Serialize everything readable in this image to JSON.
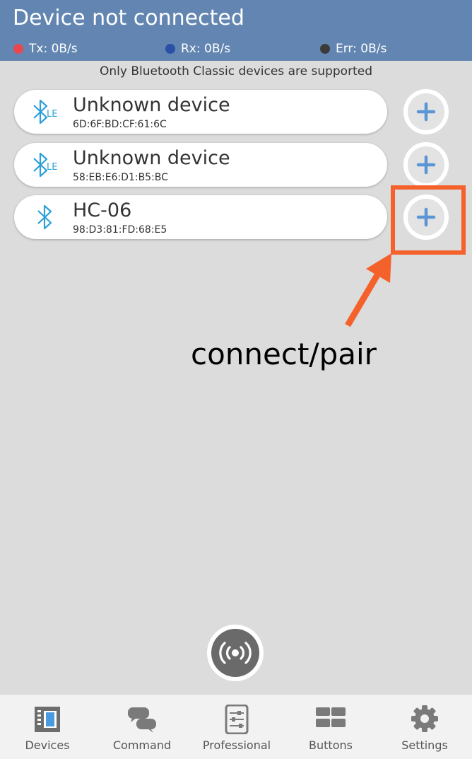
{
  "header": {
    "title": "Device not connected",
    "tx_label": "Tx: 0B/s",
    "rx_label": "Rx: 0B/s",
    "err_label": "Err: 0B/s",
    "tx_color": "#e8474f",
    "rx_color": "#2a4fa6",
    "err_color": "#3b3b3b"
  },
  "notice": "Only Bluetooth Classic devices are supported",
  "devices": [
    {
      "name": "Unknown device",
      "mac": "6D:6F:BD:CF:61:6C",
      "icon": "bluetooth-le-icon"
    },
    {
      "name": "Unknown device",
      "mac": "58:EB:E6:D1:B5:BC",
      "icon": "bluetooth-le-icon"
    },
    {
      "name": "HC-06",
      "mac": "98:D3:81:FD:68:E5",
      "icon": "bluetooth-icon"
    }
  ],
  "annotation": {
    "text": "connect/pair",
    "color": "#f4612a"
  },
  "nav": [
    {
      "label": "Devices",
      "icon": "devices-icon"
    },
    {
      "label": "Command",
      "icon": "command-icon"
    },
    {
      "label": "Professional",
      "icon": "professional-icon"
    },
    {
      "label": "Buttons",
      "icon": "buttons-icon"
    },
    {
      "label": "Settings",
      "icon": "settings-icon"
    }
  ]
}
